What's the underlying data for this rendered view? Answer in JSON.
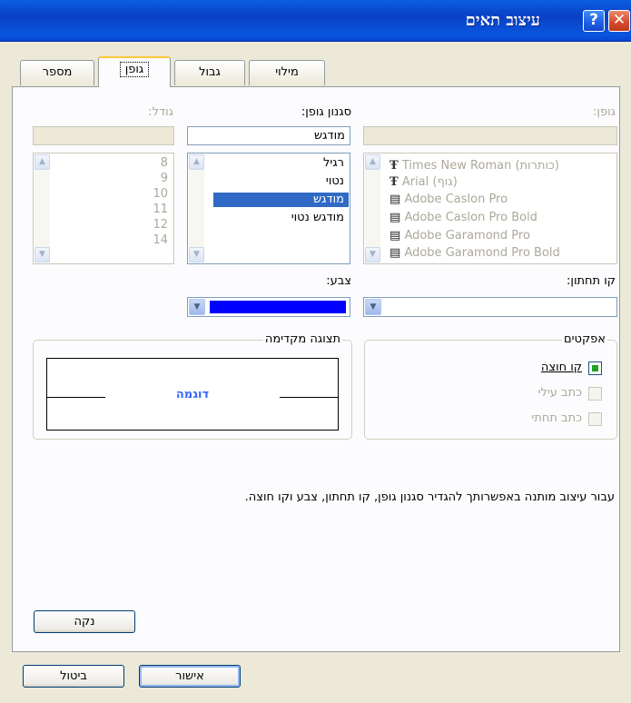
{
  "window": {
    "title": "עיצוב תאים",
    "help_label": "?",
    "close_label": "✕"
  },
  "tabs": [
    {
      "label": "מספר"
    },
    {
      "label": "גופן"
    },
    {
      "label": "גבול"
    },
    {
      "label": "מילוי"
    }
  ],
  "font": {
    "label": "גופן:",
    "current": "",
    "items": [
      {
        "label": "Times New Roman (כותרות)",
        "icon": "truetype-icon"
      },
      {
        "label": "Arial (גוף)",
        "icon": "truetype-icon"
      },
      {
        "label": "Adobe Caslon Pro",
        "icon": "opentype-icon"
      },
      {
        "label": "Adobe Caslon Pro Bold",
        "icon": "opentype-icon"
      },
      {
        "label": "Adobe Garamond Pro",
        "icon": "opentype-icon"
      },
      {
        "label": "Adobe Garamond Pro Bold",
        "icon": "opentype-icon"
      }
    ]
  },
  "style": {
    "label": "סגנון גופן:",
    "current": "מודגש",
    "items": [
      "רגיל",
      "נטוי",
      "מודגש",
      "מודגש נטוי"
    ],
    "selected": "מודגש"
  },
  "size": {
    "label": "גודל:",
    "current": "",
    "items": [
      "8",
      "9",
      "10",
      "11",
      "12",
      "14"
    ]
  },
  "underline": {
    "label": "קו תחתון:",
    "value": ""
  },
  "color": {
    "label": "צבע:",
    "value_color": "#0000ff"
  },
  "effects": {
    "title": "אפקטים",
    "items": [
      {
        "label": "קו חוצה",
        "checked": true,
        "enabled": true
      },
      {
        "label": "כתב עילי",
        "checked": false,
        "enabled": false
      },
      {
        "label": "כתב תחתי",
        "checked": false,
        "enabled": false
      }
    ]
  },
  "preview": {
    "title": "תצוגה מקדימה",
    "sample": "דוגמה",
    "sample_color": "#3366ff"
  },
  "info_text": "עבור עיצוב מותנה באפשרותך להגדיר סגנון גופן, קו תחתון, צבע וקו חוצה.",
  "buttons": {
    "clear": "נקה",
    "ok": "אישור",
    "cancel": "ביטול"
  },
  "scroll": {
    "up": "▲",
    "down": "▼",
    "dropdown": "▼"
  }
}
